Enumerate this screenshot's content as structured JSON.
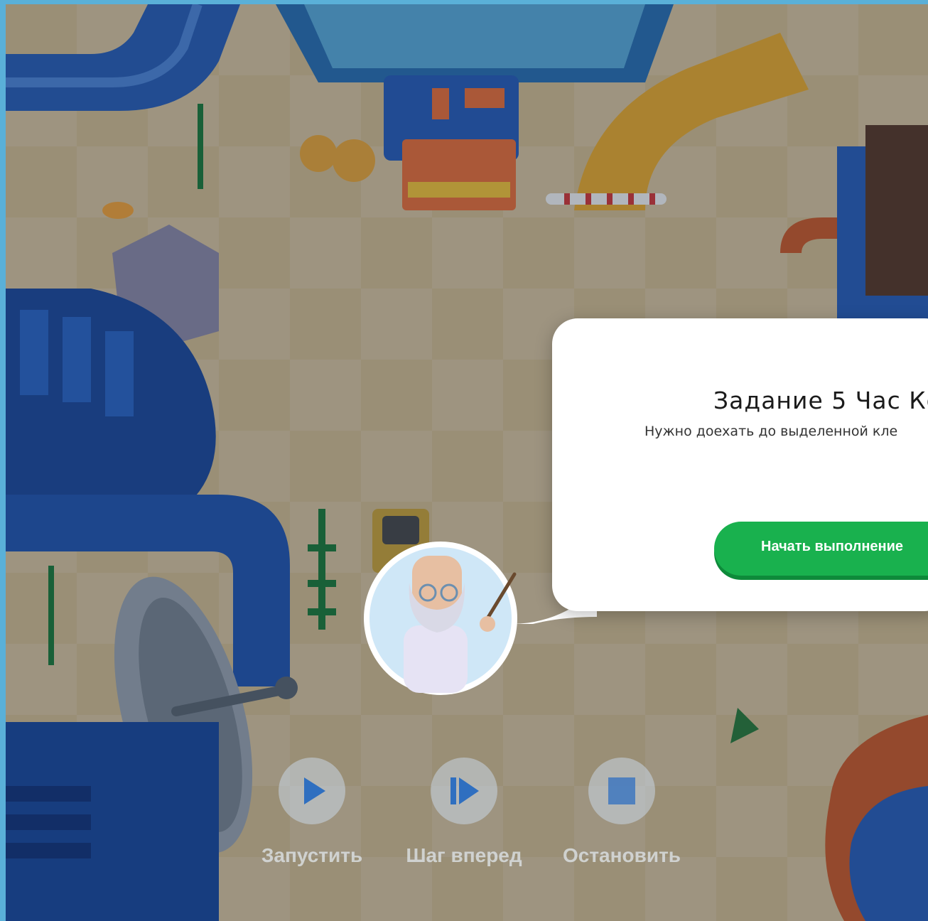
{
  "dialog": {
    "title": "Задание 5 Час Ко",
    "description": "Нужно доехать до выделенной кле",
    "start_button": "Начать выполнение"
  },
  "controls": {
    "run": "Запустить",
    "step": "Шаг вперед",
    "stop": "Остановить"
  },
  "icons": {
    "run": "play-icon",
    "step": "step-forward-icon",
    "stop": "stop-icon"
  },
  "colors": {
    "frame": "#5ab0d8",
    "start_button": "#19b14e",
    "dialog": "#ffffff"
  }
}
